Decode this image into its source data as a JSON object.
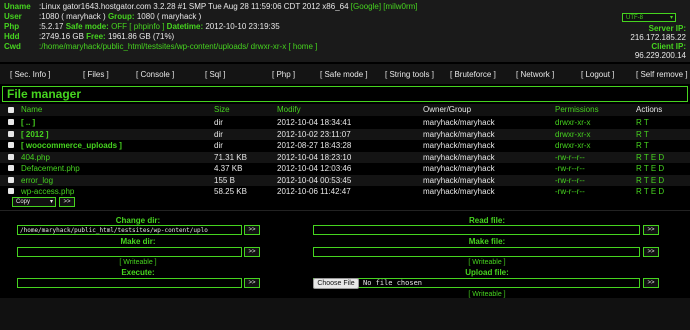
{
  "header": {
    "uname_label": "Uname",
    "uname_value": ":Linux gator1643.hostgator.com 3.2.28 #1 SMP Tue Aug 28 11:59:06 CDT 2012 x86_64",
    "uname_link1": "[Google]",
    "uname_link2": "[milw0rm]",
    "user_label": "User",
    "user_value": ":1080 ( maryhack )",
    "group_label": "Group:",
    "group_value": "1080 ( maryhack )",
    "php_label": "Php",
    "php_value": ":5.2.17",
    "safe_mode_label": "Safe mode:",
    "safe_mode_value": "OFF",
    "phpinfo_link": "[ phpinfo ]",
    "datetime_label": "Datetime:",
    "datetime_value": "2012-10-10 23:19:35",
    "hdd_label": "Hdd",
    "hdd_value": ":2749.16 GB",
    "free_label": "Free:",
    "free_value": "1961.86 GB (71%)",
    "cwd_label": "Cwd",
    "cwd_value": ":/home/maryhack/public_html/testsites/wp-content/uploads/",
    "cwd_perm": "drwxr-xr-x",
    "home_link": "[ home ]",
    "charset": "UTF-8",
    "server_ip_label": "Server IP:",
    "server_ip": "216.172.185.22",
    "client_ip_label": "Client IP:",
    "client_ip": "96.229.200.14"
  },
  "menu": [
    "[ Sec. Info ]",
    "[ Files ]",
    "[ Console ]",
    "[ Sql ]",
    "[ Php ]",
    "[ Safe mode ]",
    "[ String tools ]",
    "[ Bruteforce ]",
    "[ Network ]",
    "[ Logout ]",
    "[ Self remove ]"
  ],
  "file_manager_title": "File manager",
  "columns": {
    "name": "Name",
    "size": "Size",
    "modify": "Modify",
    "owner": "Owner/Group",
    "perms": "Permissions",
    "actions": "Actions"
  },
  "files": [
    {
      "name": "[ .. ]",
      "size": "dir",
      "modify": "2012-10-04 18:34:41",
      "owner": "maryhack/maryhack",
      "perms": "drwxr-xr-x",
      "actions": "R T",
      "dir": true
    },
    {
      "name": "[ 2012 ]",
      "size": "dir",
      "modify": "2012-10-02 23:11:07",
      "owner": "maryhack/maryhack",
      "perms": "drwxr-xr-x",
      "actions": "R T",
      "dir": true
    },
    {
      "name": "[ woocommerce_uploads ]",
      "size": "dir",
      "modify": "2012-08-27 18:43:28",
      "owner": "maryhack/maryhack",
      "perms": "drwxr-xr-x",
      "actions": "R T",
      "dir": true
    },
    {
      "name": "404.php",
      "size": "71.31 KB",
      "modify": "2012-10-04 18:23:10",
      "owner": "maryhack/maryhack",
      "perms": "-rw-r--r--",
      "actions": "R T E D",
      "dir": false
    },
    {
      "name": "Defacement.php",
      "size": "4.37 KB",
      "modify": "2012-10-04 12:03:46",
      "owner": "maryhack/maryhack",
      "perms": "-rw-r--r--",
      "actions": "R T E D",
      "dir": false
    },
    {
      "name": "error_log",
      "size": "155 B",
      "modify": "2012-10-04 00:53:45",
      "owner": "maryhack/maryhack",
      "perms": "-rw-r--r--",
      "actions": "R T E D",
      "dir": false
    },
    {
      "name": "wp-access.php",
      "size": "58.25 KB",
      "modify": "2012-10-06 11:42:47",
      "owner": "maryhack/maryhack",
      "perms": "-rw-r--r--",
      "actions": "R T E D",
      "dir": false
    }
  ],
  "file_action": {
    "selected": "Copy",
    "go": ">>"
  },
  "forms": {
    "change_dir_title": "Change dir:",
    "change_dir_value": "/home/maryhack/public_html/testsites/wp-content/uplo",
    "make_dir_title": "Make dir:",
    "execute_title": "Execute:",
    "read_file_title": "Read file:",
    "make_file_title": "Make file:",
    "upload_file_title": "Upload file:",
    "writeable": "[ Writeable ]",
    "go": ">>",
    "choose_file": "Choose File",
    "no_file": "No file chosen"
  },
  "colors": {
    "accent": "#46d41f",
    "background": "#000000",
    "header_bg": "#1a1a1a"
  }
}
